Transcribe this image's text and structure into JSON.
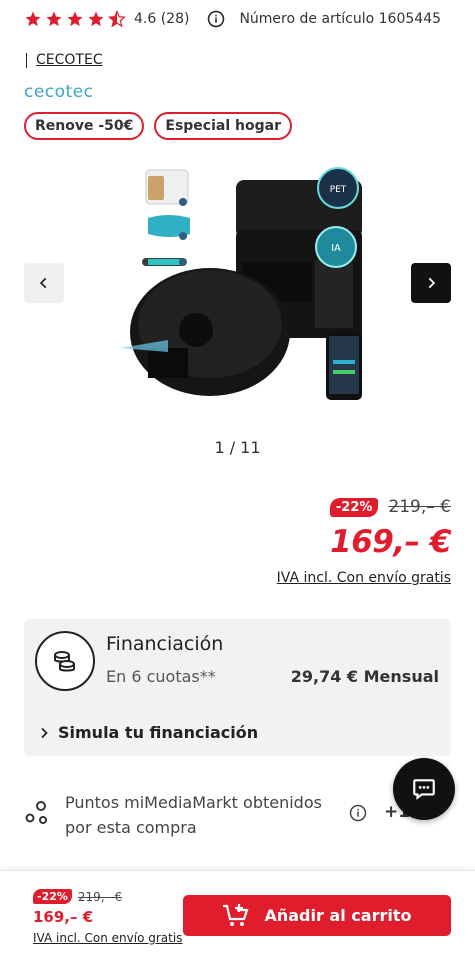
{
  "rating": {
    "value_text": "4.6 (28)",
    "stars": 4.5,
    "star_color": "#df1d2c"
  },
  "article": {
    "text": "Número de artículo 1605445"
  },
  "brand": {
    "link": "CECOTEC",
    "logo_text": "cecotec"
  },
  "tags": [
    "Renove -50€",
    "Especial hogar"
  ],
  "gallery": {
    "pager": "1 / 11",
    "prev_icon": "chevron-left-icon",
    "next_icon": "chevron-right-icon"
  },
  "price": {
    "discount": "-22%",
    "old": "219,– €",
    "current": "169,– €",
    "tax_note": "IVA incl. Con envío gratis"
  },
  "financing": {
    "title": "Financiación",
    "subtitle": "En 6 cuotas**",
    "monthly": "29,74 € Mensual",
    "simulate": "Simula tu financiación"
  },
  "points": {
    "text_line1": "Puntos miMediaMarkt obtenidos",
    "text_line2": "por esta compra",
    "value": "+169"
  },
  "bottom_bar": {
    "discount": "-22%",
    "old": "219,– €",
    "current": "169,– €",
    "tax_note": "IVA incl. Con envío gratis",
    "cart_label": "Añadir al carrito"
  },
  "colors": {
    "brand_red": "#df1d2c",
    "cecotec_blue": "#3aa6c7",
    "card_bg": "#f2f2f2"
  }
}
